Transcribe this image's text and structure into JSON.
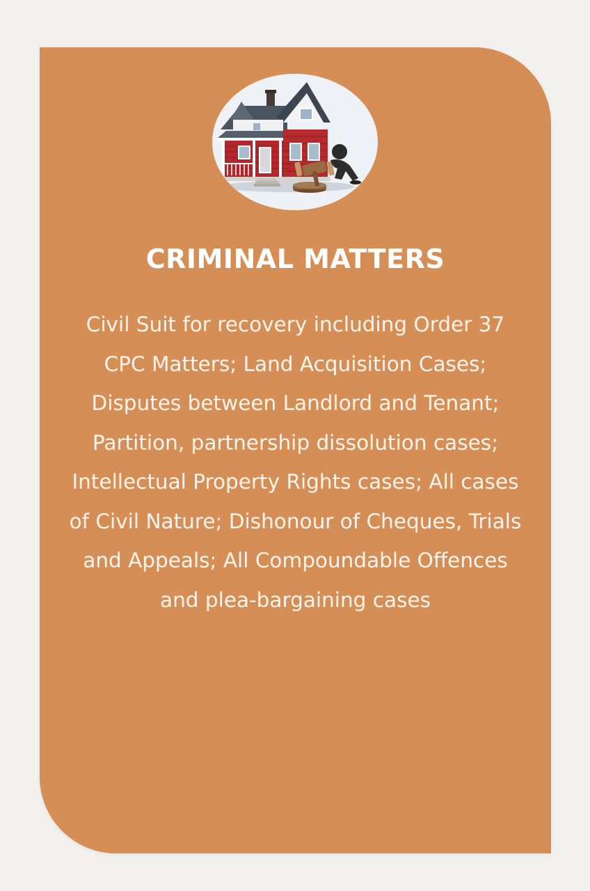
{
  "card": {
    "image_icon": "house-with-gavel-icon",
    "title": "CRIMINAL MATTERS",
    "description": "Civil Suit for recovery including Order 37 CPC Matters; Land Acquisition Cases; Disputes between Landlord and Tenant; Partition, partnership dissolution cases; Intellectual Property Rights cases; All cases of Civil Nature; Dishonour of Cheques, Trials and Appeals; All Compoundable Offences and plea-bargaining cases"
  },
  "colors": {
    "page_background": "#f3f1ee",
    "card_background": "#d68e57",
    "text": "#ffffff"
  }
}
